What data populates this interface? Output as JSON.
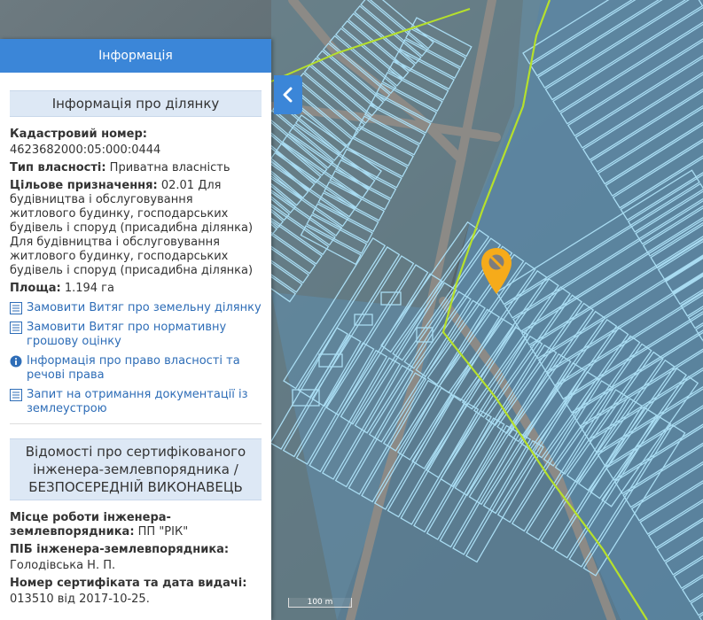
{
  "panel": {
    "header_title": "Інформація",
    "parcel_section_title": "Інформація про ділянку",
    "cadastral_label": "Кадастровий номер:",
    "cadastral_value": "4623682000:05:000:0444",
    "ownership_label": "Тип власності:",
    "ownership_value": " Приватна власність",
    "purpose_label": "Цільове призначення:",
    "purpose_value": " 02.01 Для будівництва і обслуговування житлового будинку, господарських будівель і споруд (присадибна ділянка) Для будівництва і обслуговування житлового будинку, господарських будівель і споруд (присадибна ділянка)",
    "area_label": "Площа:",
    "area_value": " 1.194 га",
    "links": [
      {
        "label": "Замовити Витяг про земельну ділянку",
        "icon": "list-icon"
      },
      {
        "label": "Замовити Витяг про нормативну грошову оцінку",
        "icon": "list-icon"
      },
      {
        "label": "Інформація про право власності та речові права",
        "icon": "info-icon"
      },
      {
        "label": "Запит на отримання документації із землеустрою",
        "icon": "list-icon"
      }
    ],
    "engineer_section_title": "Відомості про сертифікованого інженера-землевпорядника / БЕЗПОСЕРЕДНІЙ ВИКОНАВЕЦЬ",
    "workplace_label": "Місце роботи інженера-землевпорядника:",
    "workplace_value": " ПП \"РІК\"",
    "name_label": "ПІБ інженера-землевпорядника:",
    "name_value": "Голодівська Н. П.",
    "cert_label": "Номер сертифіката та дата видачі:",
    "cert_value": "013510 від 2017-10-25."
  },
  "map": {
    "scale_label": "100 m",
    "parcel_outline_color": "#a9dcf2",
    "boundary_color": "#b6e02c",
    "marker_color": "#f6ab1a"
  },
  "collapse_button": {
    "icon": "chevron-left-icon"
  }
}
